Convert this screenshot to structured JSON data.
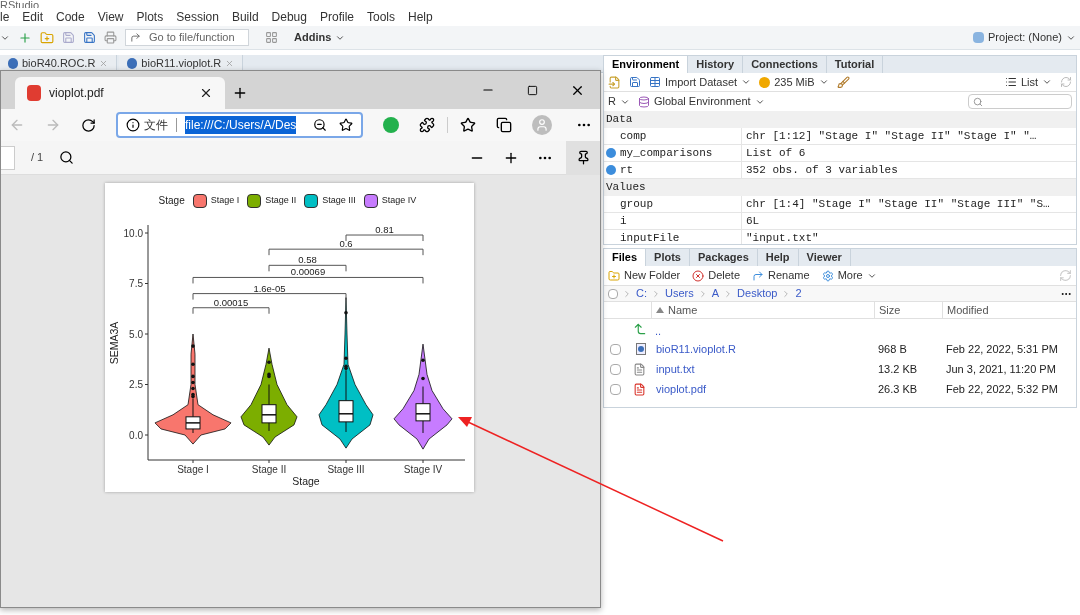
{
  "window": {
    "title": "RStudio"
  },
  "menu": [
    "le",
    "Edit",
    "Code",
    "View",
    "Plots",
    "Session",
    "Build",
    "Debug",
    "Profile",
    "Tools",
    "Help"
  ],
  "toolbar": {
    "goto_placeholder": "Go to file/function",
    "addins": "Addins",
    "project": "Project: (None)"
  },
  "editor_tabs": [
    {
      "label": "bioR40.ROC.R",
      "selected": false
    },
    {
      "label": "bioR11.vioplot.R",
      "selected": false
    }
  ],
  "browser": {
    "tab": {
      "label": "vioplot.pdf",
      "selected": true
    },
    "address_prefix": "文件",
    "url": "file:///C:/Users/A/Des",
    "url_selected": true,
    "page_count": "/ 1",
    "plot": {
      "legend_title": "Stage",
      "y_title": "SEMA3A",
      "x_title": "Stage",
      "yticks": [
        "10.0",
        "7.5",
        "5.0",
        "2.5",
        "0.0"
      ],
      "groups": [
        {
          "legend_label": "Stage I",
          "axis_label": "Stage I",
          "color": "#f8766d"
        },
        {
          "legend_label": "Stage II",
          "axis_label": "Stage II",
          "color": "#7cae00"
        },
        {
          "legend_label": "Stage III",
          "axis_label": "Stage III",
          "color": "#00bfc4"
        },
        {
          "legend_label": "Stage IV",
          "axis_label": "Stage IV",
          "color": "#c77cff"
        }
      ],
      "comparisons": [
        "0.00015",
        "1.6e-05",
        "0.00069",
        "0.58",
        "0.6",
        "0.81"
      ]
    }
  },
  "environment": {
    "tabs": [
      {
        "label": "Environment",
        "selected": true
      },
      {
        "label": "History",
        "selected": false
      },
      {
        "label": "Connections",
        "selected": false
      },
      {
        "label": "Tutorial",
        "selected": false
      }
    ],
    "import": "Import Dataset",
    "memory": "235 MiB",
    "view": "List",
    "language": "R",
    "scope": "Global Environment",
    "sections": [
      {
        "title": "Data",
        "rows": [
          {
            "name": "comp",
            "value": "chr [1:12] \"Stage I\" \"Stage II\" \"Stage I\" \"…",
            "expandable": false
          },
          {
            "name": "my_comparisons",
            "value": "List of  6",
            "expandable": true
          },
          {
            "name": "rt",
            "value": "352 obs. of 3 variables",
            "expandable": true
          }
        ]
      },
      {
        "title": "Values",
        "rows": [
          {
            "name": "group",
            "value": "chr [1:4] \"Stage I\" \"Stage II\" \"Stage III\" \"S…",
            "expandable": false
          },
          {
            "name": "i",
            "value": "6L",
            "expandable": false
          },
          {
            "name": "inputFile",
            "value": "\"input.txt\"",
            "expandable": false
          }
        ]
      }
    ]
  },
  "files": {
    "tabs": [
      {
        "label": "Files",
        "selected": true
      },
      {
        "label": "Plots",
        "selected": false
      },
      {
        "label": "Packages",
        "selected": false
      },
      {
        "label": "Help",
        "selected": false
      },
      {
        "label": "Viewer",
        "selected": false
      }
    ],
    "actions": [
      "New Folder",
      "Delete",
      "Rename",
      "More"
    ],
    "all_checked": false,
    "path": [
      "C:",
      "Users",
      "A",
      "Desktop",
      "2"
    ],
    "columns": [
      "Name",
      "Size",
      "Modified"
    ],
    "parent": "..",
    "rows": [
      {
        "kind": "r",
        "name": "bioR11.vioplot.R",
        "size": "968 B",
        "modified": "Feb 22, 2022, 5:31 PM",
        "checked": false
      },
      {
        "kind": "text",
        "name": "input.txt",
        "size": "13.2 KB",
        "modified": "Jun 3, 2021, 11:20 PM",
        "checked": false
      },
      {
        "kind": "pdf",
        "name": "vioplot.pdf",
        "size": "26.3 KB",
        "modified": "Feb 22, 2022, 5:32 PM",
        "checked": false
      }
    ]
  }
}
